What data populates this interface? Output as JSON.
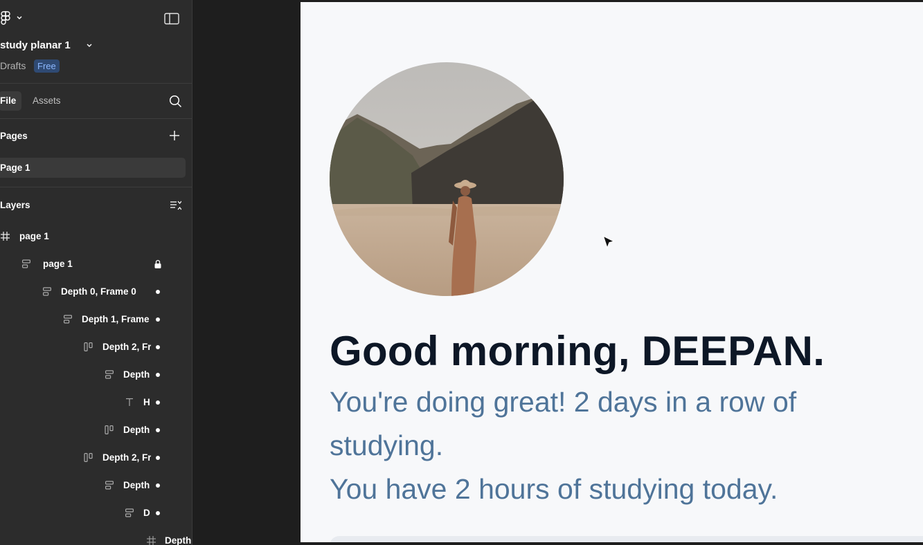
{
  "app": {
    "file_name": "study planar 1",
    "location": "Drafts",
    "plan_badge": "Free"
  },
  "tabs": {
    "file": "File",
    "assets": "Assets"
  },
  "pages": {
    "title": "Pages",
    "items": [
      {
        "label": "Page 1",
        "selected": true
      }
    ]
  },
  "layers": {
    "title": "Layers",
    "items": [
      {
        "label": "page 1",
        "icon": "frame-grid-icon"
      },
      {
        "label": "page 1",
        "icon": "auto-layout-vertical-icon",
        "locked": true
      },
      {
        "label": "Depth 0, Frame 0",
        "icon": "auto-layout-vertical-icon"
      },
      {
        "label": "Depth 1, Frame",
        "icon": "auto-layout-vertical-icon"
      },
      {
        "label": "Depth 2, Fr",
        "icon": "auto-layout-horizontal-icon"
      },
      {
        "label": "Depth",
        "icon": "auto-layout-vertical-icon"
      },
      {
        "label": "H",
        "icon": "text-icon"
      },
      {
        "label": "Depth",
        "icon": "auto-layout-horizontal-icon"
      },
      {
        "label": "Depth 2, Fr",
        "icon": "auto-layout-horizontal-icon"
      },
      {
        "label": "Depth",
        "icon": "auto-layout-vertical-icon"
      },
      {
        "label": "D",
        "icon": "auto-layout-vertical-icon"
      },
      {
        "label": "Depth",
        "icon": "frame-grid-icon"
      }
    ]
  },
  "design": {
    "greeting": "Good morning, DEEPAN.",
    "streak_text": "You're doing great! 2 days in a row of studying.",
    "hours_text": "You have 2 hours of studying today.",
    "heading_color": "#0d1726",
    "body_color": "#4f7499",
    "frame_background": "#f7f8fa"
  },
  "colors": {
    "panel_bg": "#2c2c2c",
    "canvas_bg": "#1e1e1e",
    "badge_bg": "#2f4a73",
    "badge_text": "#8cb8ff"
  }
}
